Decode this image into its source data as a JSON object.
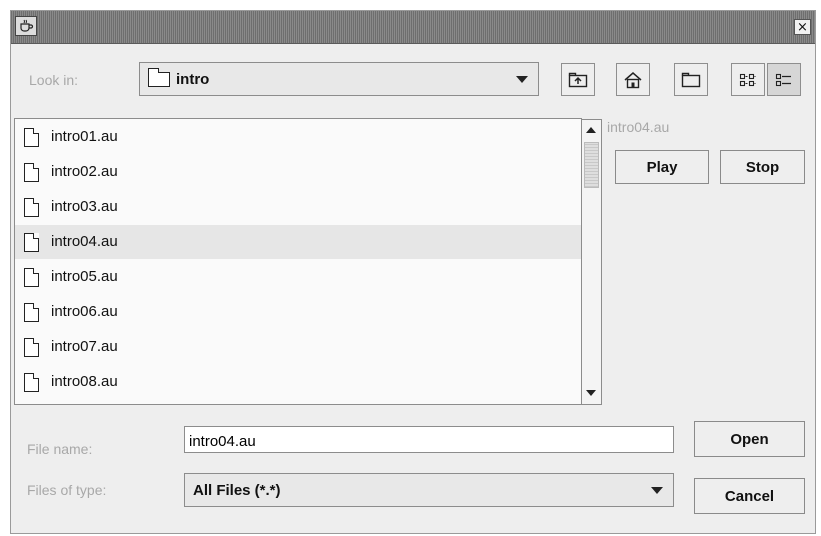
{
  "titlebar": {
    "app_icon": "java-cup-icon",
    "close_label": "×"
  },
  "look_in": {
    "label": "Look in:",
    "value": "intro",
    "icon": "folder-icon"
  },
  "toolbar": {
    "buttons": [
      {
        "name": "up-one-level-button",
        "icon": "up-folder-icon"
      },
      {
        "name": "home-button",
        "icon": "home-icon"
      },
      {
        "name": "new-folder-button",
        "icon": "new-folder-icon"
      },
      {
        "name": "list-view-button",
        "icon": "list-view-icon"
      },
      {
        "name": "details-view-button",
        "icon": "details-view-icon"
      }
    ]
  },
  "files": [
    {
      "name": "intro01.au",
      "selected": false
    },
    {
      "name": "intro02.au",
      "selected": false
    },
    {
      "name": "intro03.au",
      "selected": false
    },
    {
      "name": "intro04.au",
      "selected": true
    },
    {
      "name": "intro05.au",
      "selected": false
    },
    {
      "name": "intro06.au",
      "selected": false
    },
    {
      "name": "intro07.au",
      "selected": false
    },
    {
      "name": "intro08.au",
      "selected": false
    }
  ],
  "accessory": {
    "title": "intro04.au",
    "play_label": "Play",
    "stop_label": "Stop"
  },
  "file_name": {
    "label": "File name:",
    "value": "intro04.au"
  },
  "file_type": {
    "label": "Files of type:",
    "value": "All Files (*.*)"
  },
  "actions": {
    "open_label": "Open",
    "cancel_label": "Cancel"
  },
  "colors": {
    "background": "#eeeeee",
    "selection": "#e6e6e6",
    "disabled_text": "#a8a8a8"
  }
}
